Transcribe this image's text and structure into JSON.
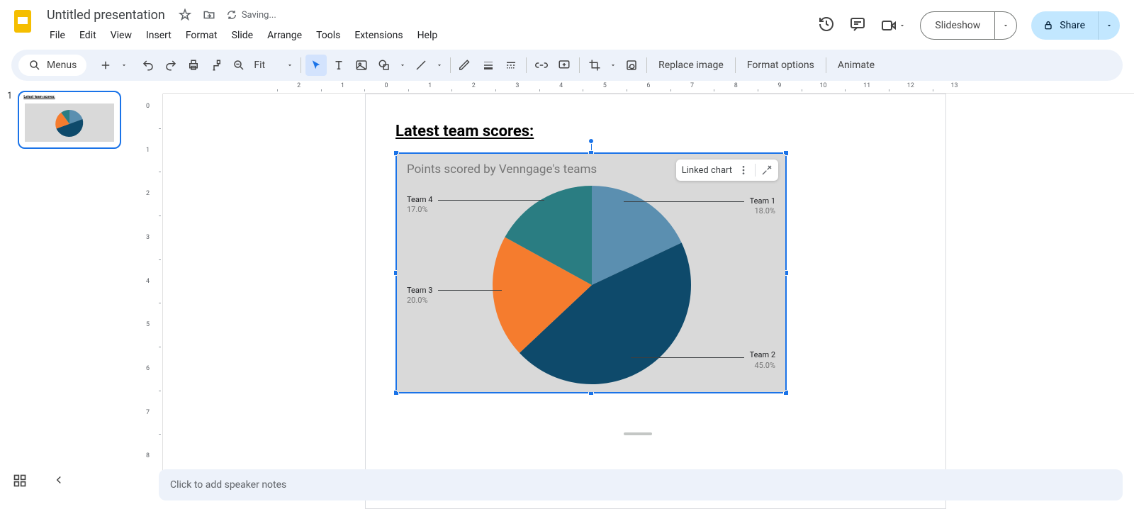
{
  "doc_title": "Untitled presentation",
  "saving": "Saving...",
  "menus": [
    "File",
    "Edit",
    "View",
    "Insert",
    "Format",
    "Slide",
    "Arrange",
    "Tools",
    "Extensions",
    "Help"
  ],
  "slideshow": "Slideshow",
  "share": "Share",
  "toolbar": {
    "search": "Menus",
    "zoom": "Fit",
    "replace_image": "Replace image",
    "format_options": "Format options",
    "animate": "Animate"
  },
  "slide": {
    "number": "1",
    "heading": "Latest team scores:"
  },
  "linked_chart_label": "Linked chart",
  "chart_data": {
    "type": "pie",
    "title": "Points scored by Venngage's teams",
    "series": [
      {
        "name": "Team 1",
        "value": 18.0,
        "label": "18.0%",
        "color": "#5b8fb0"
      },
      {
        "name": "Team 2",
        "value": 45.0,
        "label": "45.0%",
        "color": "#0e4a6b"
      },
      {
        "name": "Team 3",
        "value": 20.0,
        "label": "20.0%",
        "color": "#f57c2e"
      },
      {
        "name": "Team 4",
        "value": 17.0,
        "label": "17.0%",
        "color": "#2a7d82"
      }
    ]
  },
  "speaker_notes_placeholder": "Click to add speaker notes"
}
